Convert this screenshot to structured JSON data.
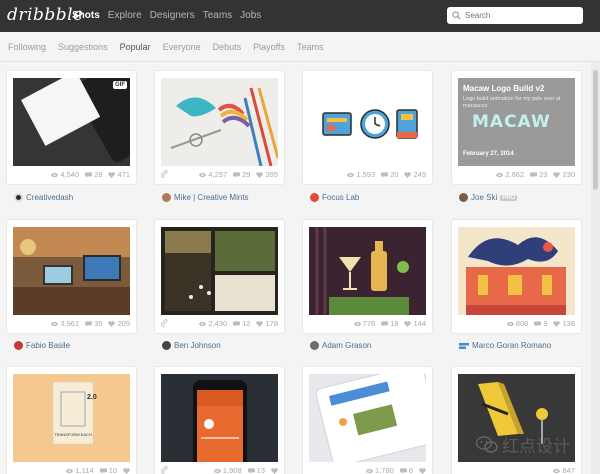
{
  "app": {
    "logo": "dribbble"
  },
  "nav": [
    "Shots",
    "Explore",
    "Designers",
    "Teams",
    "Jobs"
  ],
  "search": {
    "placeholder": "Search"
  },
  "subnav": [
    "Following",
    "Suggestions",
    "Popular",
    "Everyone",
    "Debuts",
    "Playoffs",
    "Teams"
  ],
  "shots": [
    {
      "author": "Creativedash",
      "views": "4,540",
      "comments": "29",
      "likes": "471",
      "badge": "GIF"
    },
    {
      "author": "Mike | Creative Mints",
      "views": "4,297",
      "comments": "29",
      "likes": "395"
    },
    {
      "author": "Focus Lab",
      "views": "1,593",
      "comments": "20",
      "likes": "249"
    },
    {
      "author": "Joe Ski",
      "pro": "PRO",
      "views": "2,862",
      "comments": "23",
      "likes": "230",
      "art": {
        "title": "Macaw Logo Build v2",
        "desc": "Logo build animation for my pals over at macaw.co",
        "word": "MACAW",
        "date": "February 27, 2014"
      }
    },
    {
      "author": "Fabio Basile",
      "views": "3,961",
      "comments": "35",
      "likes": "209"
    },
    {
      "author": "Ben Johnson",
      "views": "2,430",
      "comments": "12",
      "likes": "178"
    },
    {
      "author": "Adam Grason",
      "views": "776",
      "comments": "18",
      "likes": "144"
    },
    {
      "author": "Marco Goran Romano",
      "views": "808",
      "comments": "9",
      "likes": "136"
    },
    {
      "views": "1,114",
      "comments": "10",
      "likes": "",
      "art": {
        "stamp": "2.0",
        "stamp_text": "TRANSFORM EACH"
      }
    },
    {
      "views": "1,908",
      "comments": "13",
      "likes": ""
    },
    {
      "views": "1,780",
      "comments": "6",
      "likes": ""
    },
    {
      "views": "847",
      "comments": "",
      "likes": ""
    }
  ],
  "watermark": "红点设计"
}
